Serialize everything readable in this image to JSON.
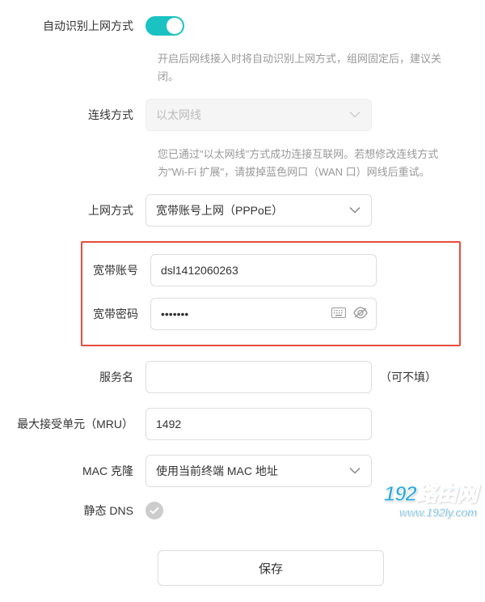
{
  "auto_detect": {
    "label": "自动识别上网方式",
    "enabled": true,
    "hint": "开启后网线接入时将自动识别上网方式，组网固定后，建议关闭。"
  },
  "connection_mode": {
    "label": "连线方式",
    "value": "以太网线",
    "hint": "您已通过\"以太网线\"方式成功连接互联网。若想修改连线方式为\"Wi-Fi 扩展\"，请拔掉蓝色网口（WAN 口）网线后重试。"
  },
  "internet_mode": {
    "label": "上网方式",
    "value": "宽带账号上网（PPPoE）"
  },
  "pppoe": {
    "account_label": "宽带账号",
    "account_value": "dsl1412060263",
    "password_label": "宽带密码",
    "password_value": "•••••••"
  },
  "service_name": {
    "label": "服务名",
    "value": "",
    "suffix": "（可不填）"
  },
  "mru": {
    "label": "最大接受单元（MRU）",
    "value": "1492"
  },
  "mac_clone": {
    "label": "MAC 克隆",
    "value": "使用当前终端 MAC 地址"
  },
  "static_dns": {
    "label": "静态 DNS",
    "enabled": false
  },
  "save_label": "保存",
  "watermark": {
    "main": "192路由网",
    "sub": "www.192ly.com"
  }
}
